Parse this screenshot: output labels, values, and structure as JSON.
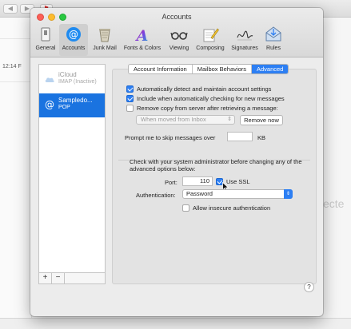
{
  "background": {
    "time": "12:14 F",
    "partial_text": "ecte"
  },
  "window": {
    "title": "Accounts",
    "toolbar": [
      {
        "label": "General",
        "icon": "general-switch-icon"
      },
      {
        "label": "Accounts",
        "icon": "at-sign-icon",
        "selected": true
      },
      {
        "label": "Junk Mail",
        "icon": "trash-bin-icon"
      },
      {
        "label": "Fonts & Colors",
        "icon": "font-a-icon"
      },
      {
        "label": "Viewing",
        "icon": "glasses-icon"
      },
      {
        "label": "Composing",
        "icon": "pencil-notepad-icon"
      },
      {
        "label": "Signatures",
        "icon": "signature-icon"
      },
      {
        "label": "Rules",
        "icon": "rules-envelope-icon"
      }
    ]
  },
  "accounts": [
    {
      "name": "iCloud",
      "sub": "IMAP (Inactive)",
      "icon": "cloud-icon",
      "selected": false
    },
    {
      "name": "Sampledo...",
      "sub": "POP",
      "icon": "at-sign-icon",
      "selected": true
    }
  ],
  "account_buttons": {
    "add": "+",
    "remove": "−"
  },
  "tabs": [
    {
      "label": "Account Information",
      "active": false
    },
    {
      "label": "Mailbox Behaviors",
      "active": false
    },
    {
      "label": "Advanced",
      "active": true
    }
  ],
  "options": {
    "auto_detect": {
      "label": "Automatically detect and maintain account settings",
      "checked": true
    },
    "include_check": {
      "label": "Include when automatically checking for new messages",
      "checked": true
    },
    "remove_copy": {
      "label": "Remove copy from server after retrieving a message:",
      "checked": false
    },
    "remove_when": "When moved from Inbox",
    "remove_now": "Remove now",
    "skip_prefix": "Prompt me to skip messages over",
    "skip_value": "",
    "skip_unit": "KB"
  },
  "advanced": {
    "notice": "Check with your system administrator before changing any of the advanced options below:",
    "port_label": "Port:",
    "port_value": "110",
    "use_ssl": {
      "label": "Use SSL",
      "checked": true
    },
    "auth_label": "Authentication:",
    "auth_value": "Password",
    "insecure": {
      "label": "Allow insecure authentication",
      "checked": false
    }
  },
  "help": "?",
  "colors": {
    "accent": "#2d7ff3",
    "selection": "#1a73e0"
  }
}
